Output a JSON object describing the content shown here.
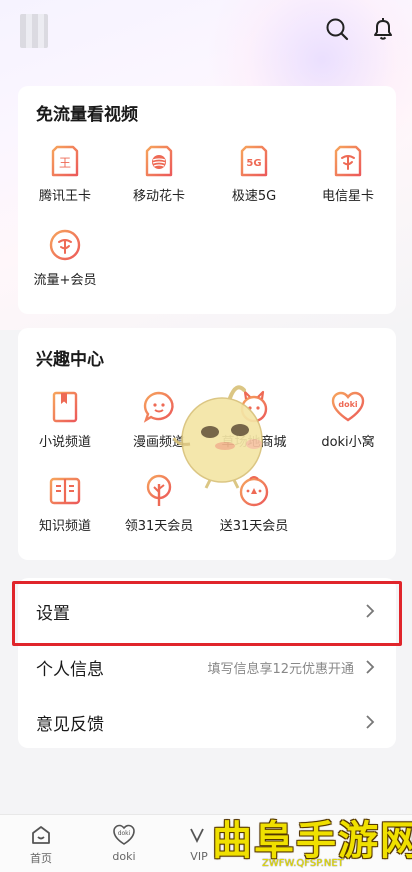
{
  "header": {
    "search_icon": "search-icon",
    "bell_icon": "bell-icon"
  },
  "free_data": {
    "title": "免流量看视频",
    "items": [
      {
        "label": "腾讯王卡",
        "icon": "king-card-icon",
        "glyph": "王"
      },
      {
        "label": "移动花卡",
        "icon": "flower-card-icon",
        "glyph": ""
      },
      {
        "label": "极速5G",
        "icon": "5g-icon",
        "glyph": "5G"
      },
      {
        "label": "电信星卡",
        "icon": "star-card-icon",
        "glyph": ""
      },
      {
        "label": "流量+会员",
        "icon": "data-member-icon",
        "glyph": ""
      }
    ]
  },
  "interest": {
    "title": "兴趣中心",
    "items": [
      {
        "label": "小说频道",
        "icon": "novel-icon"
      },
      {
        "label": "漫画频道",
        "icon": "comic-icon"
      },
      {
        "label": "草场地商城",
        "icon": "shop-icon"
      },
      {
        "label": "doki小窝",
        "icon": "doki-heart-icon",
        "glyph": "doki"
      },
      {
        "label": "知识频道",
        "icon": "knowledge-icon"
      },
      {
        "label": "领31天会员",
        "icon": "tree-icon"
      },
      {
        "label": "送31天会员",
        "icon": "gift-face-icon"
      }
    ]
  },
  "menu": {
    "settings": {
      "label": "设置"
    },
    "profile": {
      "label": "个人信息",
      "hint": "填写信息享12元优惠开通"
    },
    "feedback": {
      "label": "意见反馈"
    }
  },
  "bottom_nav": [
    {
      "label": "首页",
      "icon": "home-icon"
    },
    {
      "label": "doki",
      "icon": "doki-nav-icon",
      "glyph": "doki"
    },
    {
      "label": "VIP",
      "icon": "vip-icon"
    }
  ],
  "watermark": {
    "main": "曲阜手游网",
    "sub": "ZWFW.QFSP.NET"
  },
  "colors": {
    "accent": "#f0835a",
    "highlight_box": "#e0252b",
    "watermark": "#f0e000"
  }
}
